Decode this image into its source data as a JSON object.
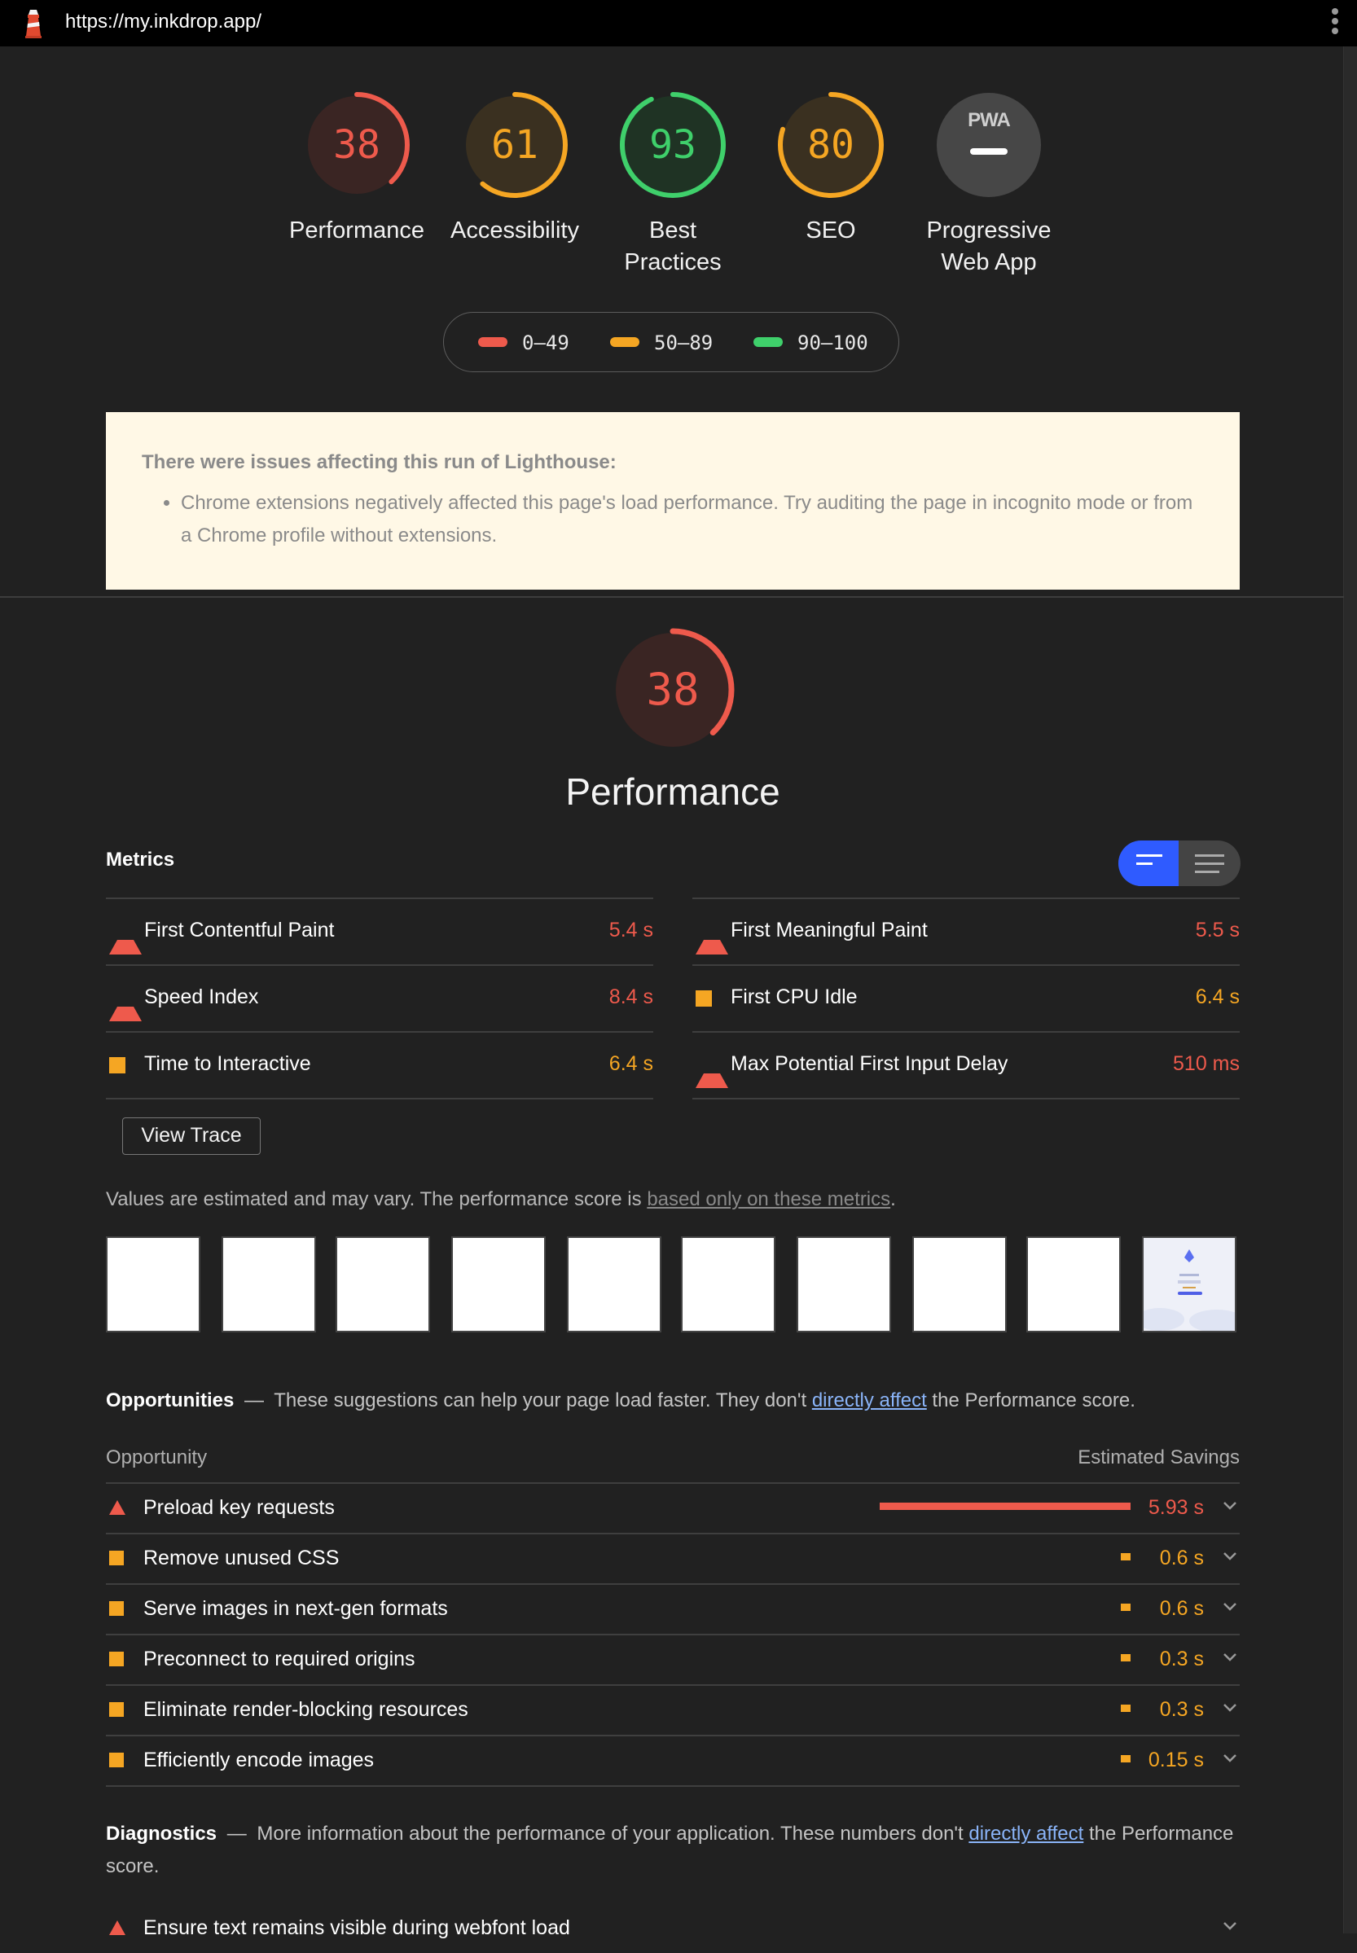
{
  "browser": {
    "url": "https://my.inkdrop.app/"
  },
  "colors": {
    "fail": "#ee5a4c",
    "average": "#f5a623",
    "pass": "#3fd06b",
    "neutral": "#4a4a4a",
    "link": "#8ab4f8"
  },
  "gauges": [
    {
      "score": "38",
      "label": "Performance",
      "fraction": 0.38,
      "status": "fail"
    },
    {
      "score": "61",
      "label": "Accessibility",
      "fraction": 0.61,
      "status": "average"
    },
    {
      "score": "93",
      "label": "Best Practices",
      "fraction": 0.93,
      "status": "pass"
    },
    {
      "score": "80",
      "label": "SEO",
      "fraction": 0.8,
      "status": "average"
    },
    {
      "score": "PWA",
      "label": "Progressive Web App",
      "fraction": 0,
      "status": "neutral"
    }
  ],
  "legend": {
    "fail": "0–49",
    "average": "50–89",
    "pass": "90–100"
  },
  "warning": {
    "title": "There were issues affecting this run of Lighthouse:",
    "item": "Chrome extensions negatively affected this page's load performance. Try auditing the page in incognito mode or from a Chrome profile without extensions."
  },
  "performance": {
    "score": "38",
    "score_fraction": 0.38,
    "title": "Performance",
    "metrics_title": "Metrics",
    "metrics": [
      {
        "name": "First Contentful Paint",
        "value": "5.4 s",
        "status": "fail"
      },
      {
        "name": "First Meaningful Paint",
        "value": "5.5 s",
        "status": "fail"
      },
      {
        "name": "Speed Index",
        "value": "8.4 s",
        "status": "fail"
      },
      {
        "name": "First CPU Idle",
        "value": "6.4 s",
        "status": "average"
      },
      {
        "name": "Time to Interactive",
        "value": "6.4 s",
        "status": "average"
      },
      {
        "name": "Max Potential First Input Delay",
        "value": "510 ms",
        "status": "fail"
      }
    ],
    "view_trace": "View Trace",
    "note_text": "Values are estimated and may vary. The performance score is ",
    "note_link": "based only on these metrics",
    "note_end": "."
  },
  "opportunities": {
    "title": "Opportunities",
    "dash": "—",
    "desc_before": "These suggestions can help your page load faster. They don't ",
    "link": "directly affect",
    "desc_after": " the Performance score.",
    "col_left": "Opportunity",
    "col_right": "Estimated Savings",
    "items": [
      {
        "name": "Preload key requests",
        "value": "5.93 s",
        "seconds": 5.93,
        "status": "fail"
      },
      {
        "name": "Remove unused CSS",
        "value": "0.6 s",
        "seconds": 0.6,
        "status": "average"
      },
      {
        "name": "Serve images in next-gen formats",
        "value": "0.6 s",
        "seconds": 0.6,
        "status": "average"
      },
      {
        "name": "Preconnect to required origins",
        "value": "0.3 s",
        "seconds": 0.3,
        "status": "average"
      },
      {
        "name": "Eliminate render-blocking resources",
        "value": "0.3 s",
        "seconds": 0.3,
        "status": "average"
      },
      {
        "name": "Efficiently encode images",
        "value": "0.15 s",
        "seconds": 0.15,
        "status": "average"
      }
    ]
  },
  "diagnostics": {
    "title": "Diagnostics",
    "dash": "—",
    "desc_before": "More information about the performance of your application. These numbers don't ",
    "link": "directly affect",
    "desc_after": " the Performance score.",
    "first_item": "Ensure text remains visible during webfont load"
  }
}
